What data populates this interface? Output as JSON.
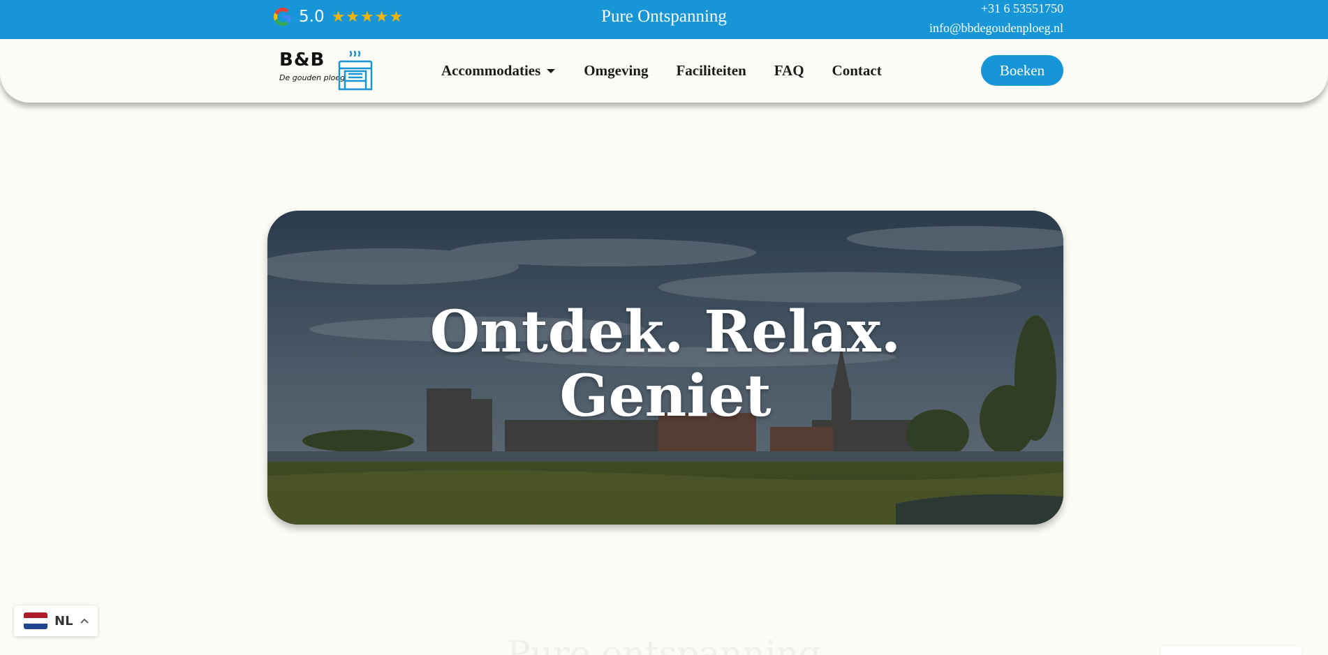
{
  "topbar": {
    "rating_score": "5.0",
    "stars": "★★★★★",
    "tagline": "Pure Ontspanning",
    "phone": "+31 6 53551750",
    "email": "info@bbdegoudenploeg.nl"
  },
  "header": {
    "logo_title": "B&B",
    "logo_subtitle": "De gouden ploeg",
    "nav": [
      {
        "label": "Accommodaties"
      },
      {
        "label": "Omgeving"
      },
      {
        "label": "Faciliteiten"
      },
      {
        "label": "FAQ"
      },
      {
        "label": "Contact"
      }
    ],
    "book_label": "Boeken"
  },
  "hero": {
    "title_line1": "Ontdek. Relax.",
    "title_line2": "Geniet"
  },
  "next_section": {
    "heading": "Pure ontspanning"
  },
  "language": {
    "code": "NL"
  },
  "colors": {
    "brand_blue": "#1696d6",
    "star_yellow": "#f7b500",
    "page_background": "#fcfbf5"
  }
}
